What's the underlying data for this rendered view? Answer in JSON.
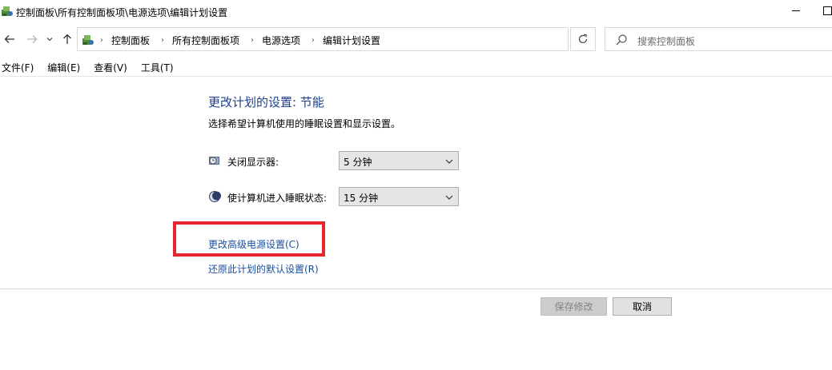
{
  "window": {
    "title": "控制面板\\所有控制面板项\\电源选项\\编辑计划设置",
    "icon": "control-panel-icon"
  },
  "nav": {
    "back_icon": "arrow-left-icon",
    "forward_icon": "arrow-right-icon",
    "recent_icon": "chevron-down-icon",
    "up_icon": "arrow-up-icon"
  },
  "address": {
    "crumbs": [
      "控制面板",
      "所有控制面板项",
      "电源选项",
      "编辑计划设置"
    ],
    "separator": "›"
  },
  "search": {
    "placeholder": "搜索控制面板"
  },
  "menu": {
    "items": [
      "文件(F)",
      "编辑(E)",
      "查看(V)",
      "工具(T)"
    ]
  },
  "main": {
    "title": "更改计划的设置: 节能",
    "description": "选择希望计算机使用的睡眠设置和显示设置。",
    "display_off": {
      "label": "关闭显示器:",
      "value": "5 分钟"
    },
    "sleep": {
      "label": "使计算机进入睡眠状态:",
      "value": "15 分钟"
    },
    "advanced_link": "更改高级电源设置(C)",
    "restore_link": "还原此计划的默认设置(R)"
  },
  "buttons": {
    "save": "保存修改",
    "cancel": "取消"
  },
  "colors": {
    "title_blue": "#1e3f8a",
    "link_blue": "#1a4f9e",
    "highlight_red": "#e8242e"
  }
}
